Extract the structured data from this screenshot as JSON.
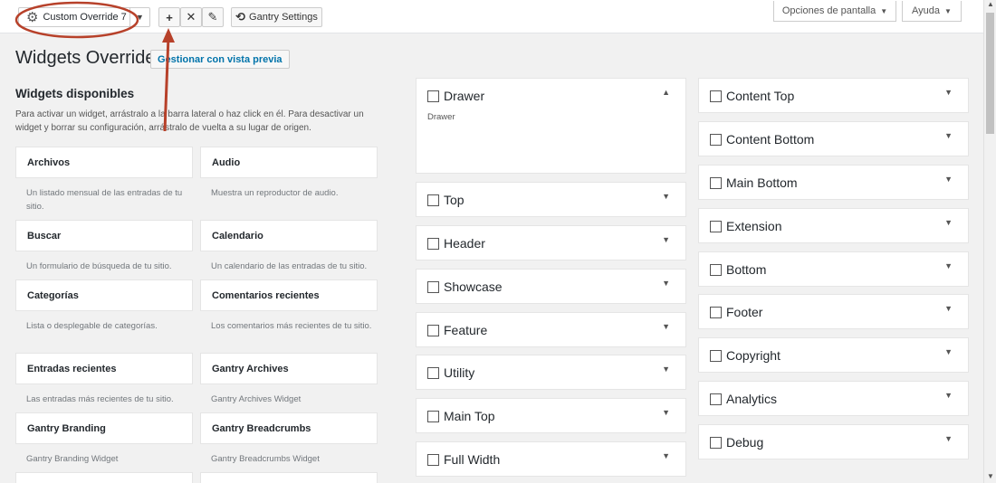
{
  "toolbar": {
    "override_name": "Custom Override 7",
    "add_label": "+",
    "delete_label": "✕",
    "edit_label": "✎",
    "gantry_label": "Gantry Settings",
    "screen_options": "Opciones de pantalla",
    "help": "Ayuda"
  },
  "page": {
    "title": "Widgets Override",
    "manage_button": "Gestionar con vista previa",
    "available_title": "Widgets disponibles",
    "available_desc": "Para activar un widget, arrástralo a la barra lateral o haz click en él. Para desactivar un widget y borrar su configuración, arrástralo de vuelta a su lugar de origen."
  },
  "widgets": [
    {
      "name": "Archivos",
      "desc": "Un listado mensual de las entradas de tu sitio."
    },
    {
      "name": "Audio",
      "desc": "Muestra un reproductor de audio."
    },
    {
      "name": "Buscar",
      "desc": "Un formulario de búsqueda de tu sitio."
    },
    {
      "name": "Calendario",
      "desc": "Un calendario de las entradas de tu sitio."
    },
    {
      "name": "Categorías",
      "desc": "Lista o desplegable de categorías."
    },
    {
      "name": "Comentarios recientes",
      "desc": "Los comentarios más recientes de tu sitio."
    },
    {
      "name": "Entradas recientes",
      "desc": "Las entradas más recientes de tu sitio."
    },
    {
      "name": "Gantry Archives",
      "desc": "Gantry Archives Widget"
    },
    {
      "name": "Gantry Branding",
      "desc": "Gantry Branding Widget"
    },
    {
      "name": "Gantry Breadcrumbs",
      "desc": "Gantry Breadcrumbs Widget"
    }
  ],
  "areas_col1": [
    {
      "name": "Drawer",
      "sub": "Drawer",
      "expanded": true
    },
    {
      "name": "Top"
    },
    {
      "name": "Header"
    },
    {
      "name": "Showcase"
    },
    {
      "name": "Feature"
    },
    {
      "name": "Utility"
    },
    {
      "name": "Main Top"
    },
    {
      "name": "Full Width"
    }
  ],
  "areas_col2": [
    {
      "name": "Content Top"
    },
    {
      "name": "Content Bottom"
    },
    {
      "name": "Main Bottom"
    },
    {
      "name": "Extension"
    },
    {
      "name": "Bottom"
    },
    {
      "name": "Footer"
    },
    {
      "name": "Copyright"
    },
    {
      "name": "Analytics"
    },
    {
      "name": "Debug"
    }
  ],
  "colors": {
    "annotation": "#b7412a",
    "link": "#0073aa"
  }
}
